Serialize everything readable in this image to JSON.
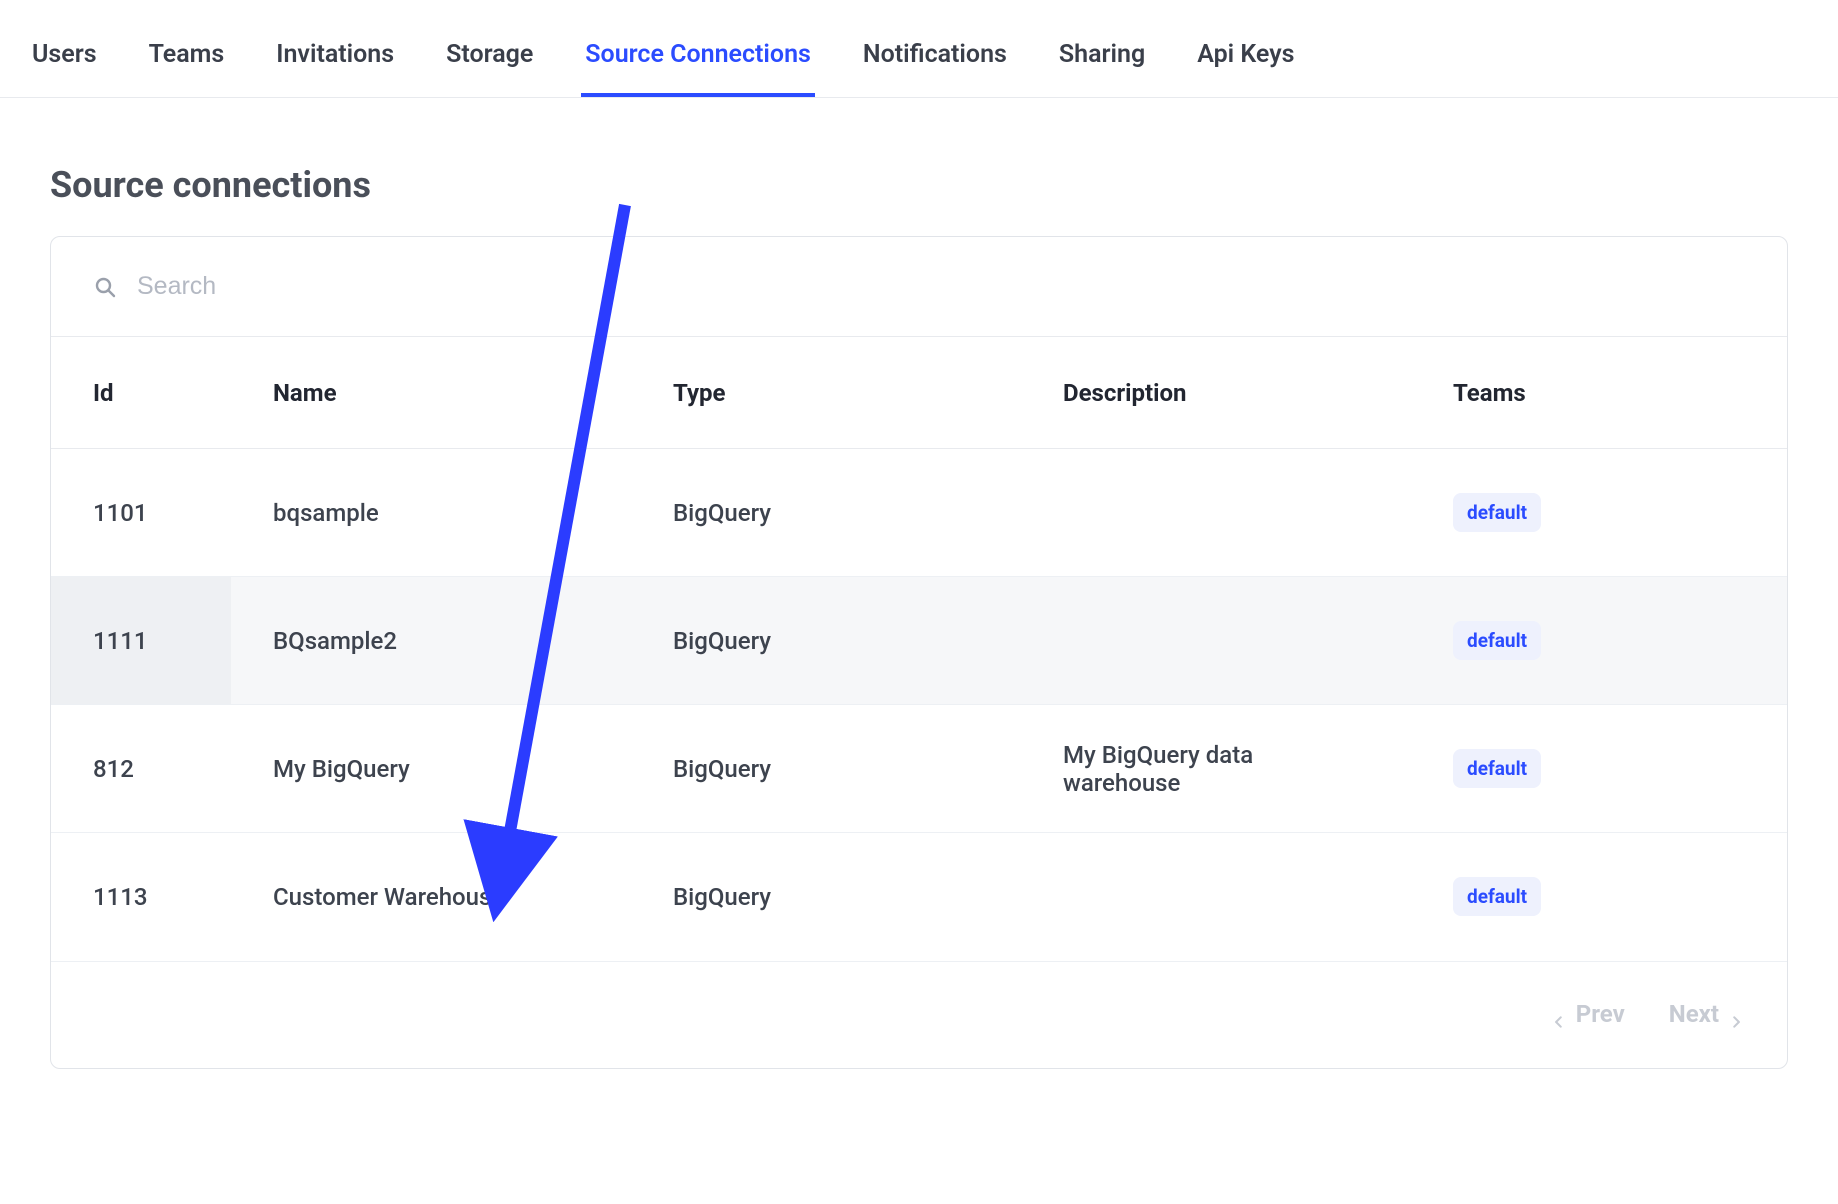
{
  "tabs": [
    {
      "label": "Users",
      "active": false
    },
    {
      "label": "Teams",
      "active": false
    },
    {
      "label": "Invitations",
      "active": false
    },
    {
      "label": "Storage",
      "active": false
    },
    {
      "label": "Source Connections",
      "active": true
    },
    {
      "label": "Notifications",
      "active": false
    },
    {
      "label": "Sharing",
      "active": false
    },
    {
      "label": "Api Keys",
      "active": false
    }
  ],
  "heading": "Source connections",
  "search": {
    "placeholder": "Search",
    "value": ""
  },
  "columns": {
    "id": "Id",
    "name": "Name",
    "type": "Type",
    "description": "Description",
    "teams": "Teams"
  },
  "rows": [
    {
      "id": "1101",
      "name": "bqsample",
      "type": "BigQuery",
      "description": "",
      "team": "default",
      "highlight": false
    },
    {
      "id": "1111",
      "name": "BQsample2",
      "type": "BigQuery",
      "description": "",
      "team": "default",
      "highlight": true
    },
    {
      "id": "812",
      "name": "My BigQuery",
      "type": "BigQuery",
      "description": "My BigQuery data warehouse",
      "team": "default",
      "highlight": false
    },
    {
      "id": "1113",
      "name": "Customer Warehouse",
      "type": "BigQuery",
      "description": "",
      "team": "default",
      "highlight": false
    }
  ],
  "pagination": {
    "prev": "Prev",
    "next": "Next"
  }
}
